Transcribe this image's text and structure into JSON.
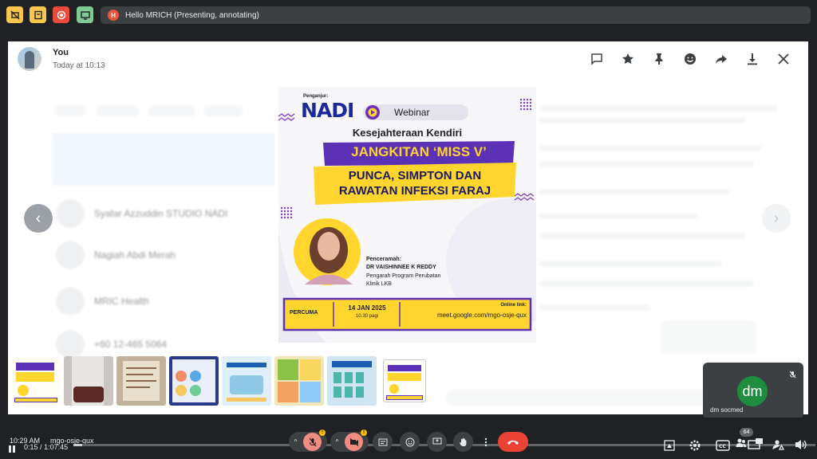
{
  "topbar": {
    "presentation_text": "Hello MRICH (Presenting, annotating)",
    "presenter_initial": "H",
    "icons": [
      "hide-icon",
      "keep-icon",
      "record-icon",
      "screen-icon"
    ]
  },
  "viewer": {
    "user_name": "You",
    "timestamp": "Today at 10:13",
    "header_icons": [
      "comment-icon",
      "star-icon",
      "pin-icon",
      "emoji-icon",
      "forward-icon",
      "download-icon",
      "close-icon"
    ],
    "nav_prev": "‹",
    "nav_next": "›"
  },
  "poster": {
    "organizer_label": "Penganjur:",
    "organizer_name": "NADI",
    "webinar_label": "Webinar",
    "subtitle": "Kesejahteraan Kendiri",
    "headline": "JANGKITAN ‘MISS V’",
    "headline2_line1": "PUNCA, SIMPTON DAN",
    "headline2_line2": "RAWATAN INFEKSI FARAJ",
    "speaker_label": "Penceramah:",
    "speaker_name": "DR VAISHINNEE K REDDY",
    "speaker_role": "Pengarah Program Perubatan",
    "speaker_org": "Klinik LKB",
    "fee": "PERCUMA",
    "date": "14 JAN 2025",
    "time": "10.30 pagi",
    "link_label": "Online link:",
    "link": "meet.google.com/mgo-osje-qux"
  },
  "background": {
    "rows": [
      {
        "title": "Syafar Azzuddin STUDIO NADI",
        "sub": ""
      },
      {
        "title": "Nagiah Abdi Merah",
        "sub": ""
      },
      {
        "title": "MRIC Health",
        "sub": ""
      },
      {
        "title": "+60 12-465 5064",
        "sub": ""
      }
    ]
  },
  "thumbnails": {
    "count": 8,
    "selected_index": 7
  },
  "participant": {
    "initials": "dm",
    "name": "dm socmed"
  },
  "controls": {
    "clock_fragment": "10:29 AM",
    "meeting_code": "mgo-osje-qux",
    "time_elapsed": "0:15",
    "time_total": "1:07:45",
    "progress_fraction": 0.012,
    "people_count": "64"
  }
}
